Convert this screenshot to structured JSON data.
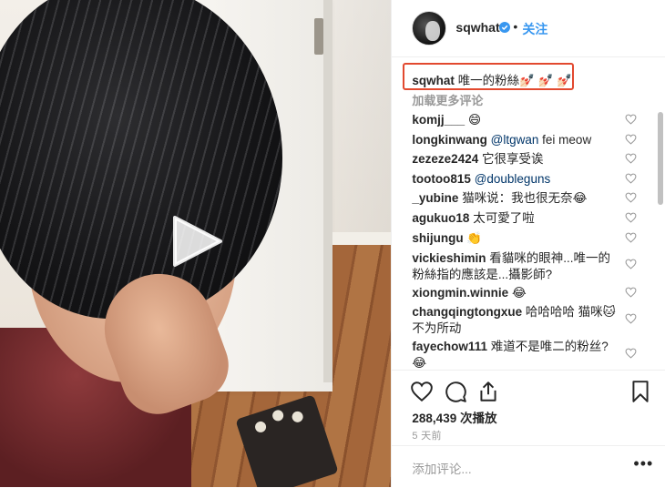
{
  "post": {
    "username": "sqwhat",
    "dot": "•",
    "follow_label": "关注"
  },
  "caption": {
    "username": "sqwhat",
    "text": "唯一的粉絲💅🏻 💅🏻 💅🏻"
  },
  "load_more": "加载更多评论",
  "comments": [
    {
      "user": "komjj___",
      "mention": "",
      "text": "😄"
    },
    {
      "user": "longkinwang",
      "mention": "@ltgwan",
      "text": "fei meow"
    },
    {
      "user": "zezeze2424",
      "mention": "",
      "text": "它很享受诶"
    },
    {
      "user": "tootoo815",
      "mention": "@doubleguns",
      "text": ""
    },
    {
      "user": "_yubine",
      "mention": "",
      "text": "猫咪说：我也很无奈😂"
    },
    {
      "user": "agukuo18",
      "mention": "",
      "text": "太可愛了啦"
    },
    {
      "user": "shijungu",
      "mention": "",
      "text": "👏"
    },
    {
      "user": "vickieshimin",
      "mention": "",
      "text": "看貓咪的眼神...唯一的粉絲指的應該是...攝影師?"
    },
    {
      "user": "xiongmin.winnie",
      "mention": "",
      "text": "😂"
    },
    {
      "user": "changqingtongxue",
      "mention": "",
      "text": "哈哈哈哈 猫咪🐱不为所动"
    },
    {
      "user": "fayechow111",
      "mention": "",
      "text": "难道不是唯二的粉丝?😂"
    }
  ],
  "likes": "288,439 次播放",
  "time": "5 天前",
  "comment_placeholder": "添加评论...",
  "more_label": "•••",
  "colors": {
    "follow": "#3897f0",
    "verified": "#3897f0",
    "highlight_box": "#e2492f",
    "muted": "#999999"
  },
  "icons": [
    "play-icon",
    "verified-badge-icon",
    "heart-icon",
    "comment-icon",
    "share-icon",
    "bookmark-icon",
    "more-options-icon"
  ]
}
